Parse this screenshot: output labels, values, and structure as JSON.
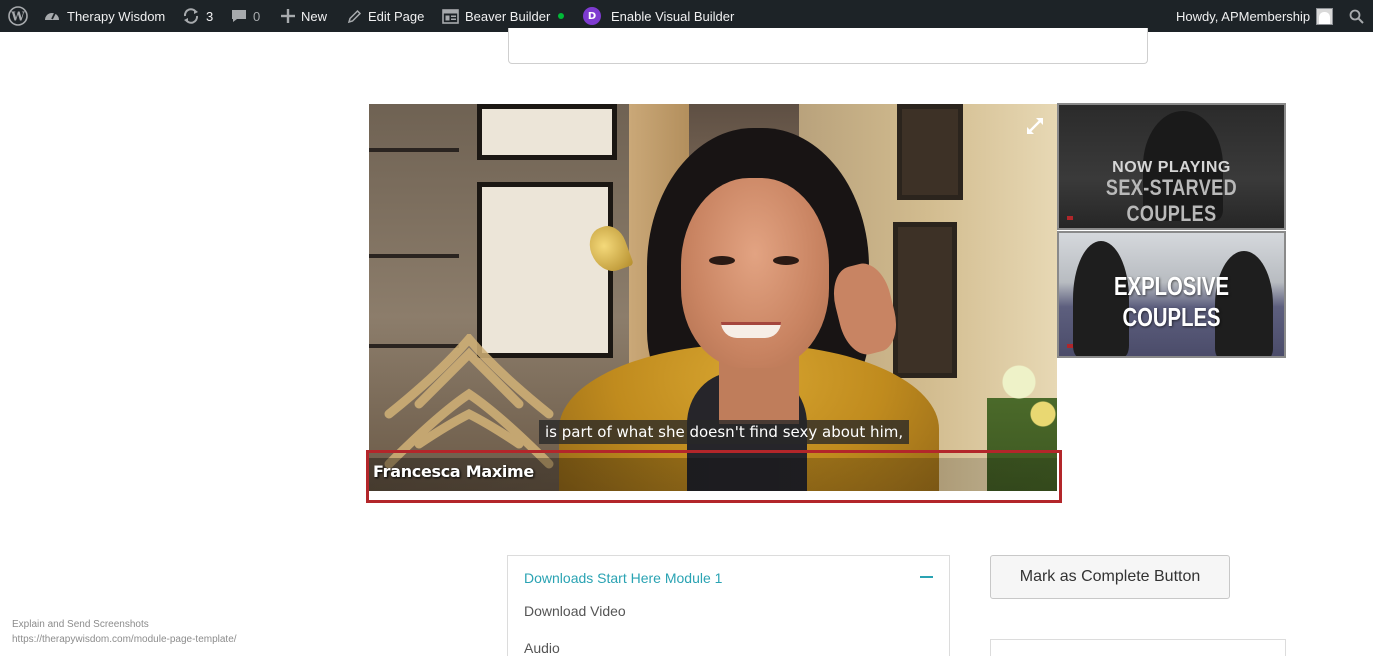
{
  "adminbar": {
    "site_name": "Therapy Wisdom",
    "updates_count": "3",
    "comments_count": "0",
    "new_label": "New",
    "edit_page_label": "Edit Page",
    "beaver_builder_label": "Beaver Builder",
    "divi_badge": "D",
    "visual_builder_label": "Enable Visual Builder",
    "howdy_label": "Howdy, APMembership"
  },
  "video": {
    "caption": "is part of what she doesn't find sexy about him,",
    "speaker_name": "Francesca Maxime"
  },
  "playlist": {
    "items": [
      {
        "status": "NOW PLAYING",
        "title": "SEX-STARVED COUPLES"
      },
      {
        "title": "EXPLOSIVE COUPLES"
      }
    ]
  },
  "downloads": {
    "title": "Downloads Start Here Module 1",
    "items": [
      "Download Video",
      "Audio"
    ]
  },
  "complete_button_label": "Mark as Complete Button",
  "watermark": {
    "line1": "Explain and Send Screenshots",
    "line2": "https://therapywisdom.com/module-page-template/"
  },
  "colors": {
    "adminbar_bg": "#1d2327",
    "accent_teal": "#2aa3b3",
    "highlight_red": "#b3262a",
    "divi_purple": "#7e3bd0",
    "status_green": "#00ba37"
  }
}
